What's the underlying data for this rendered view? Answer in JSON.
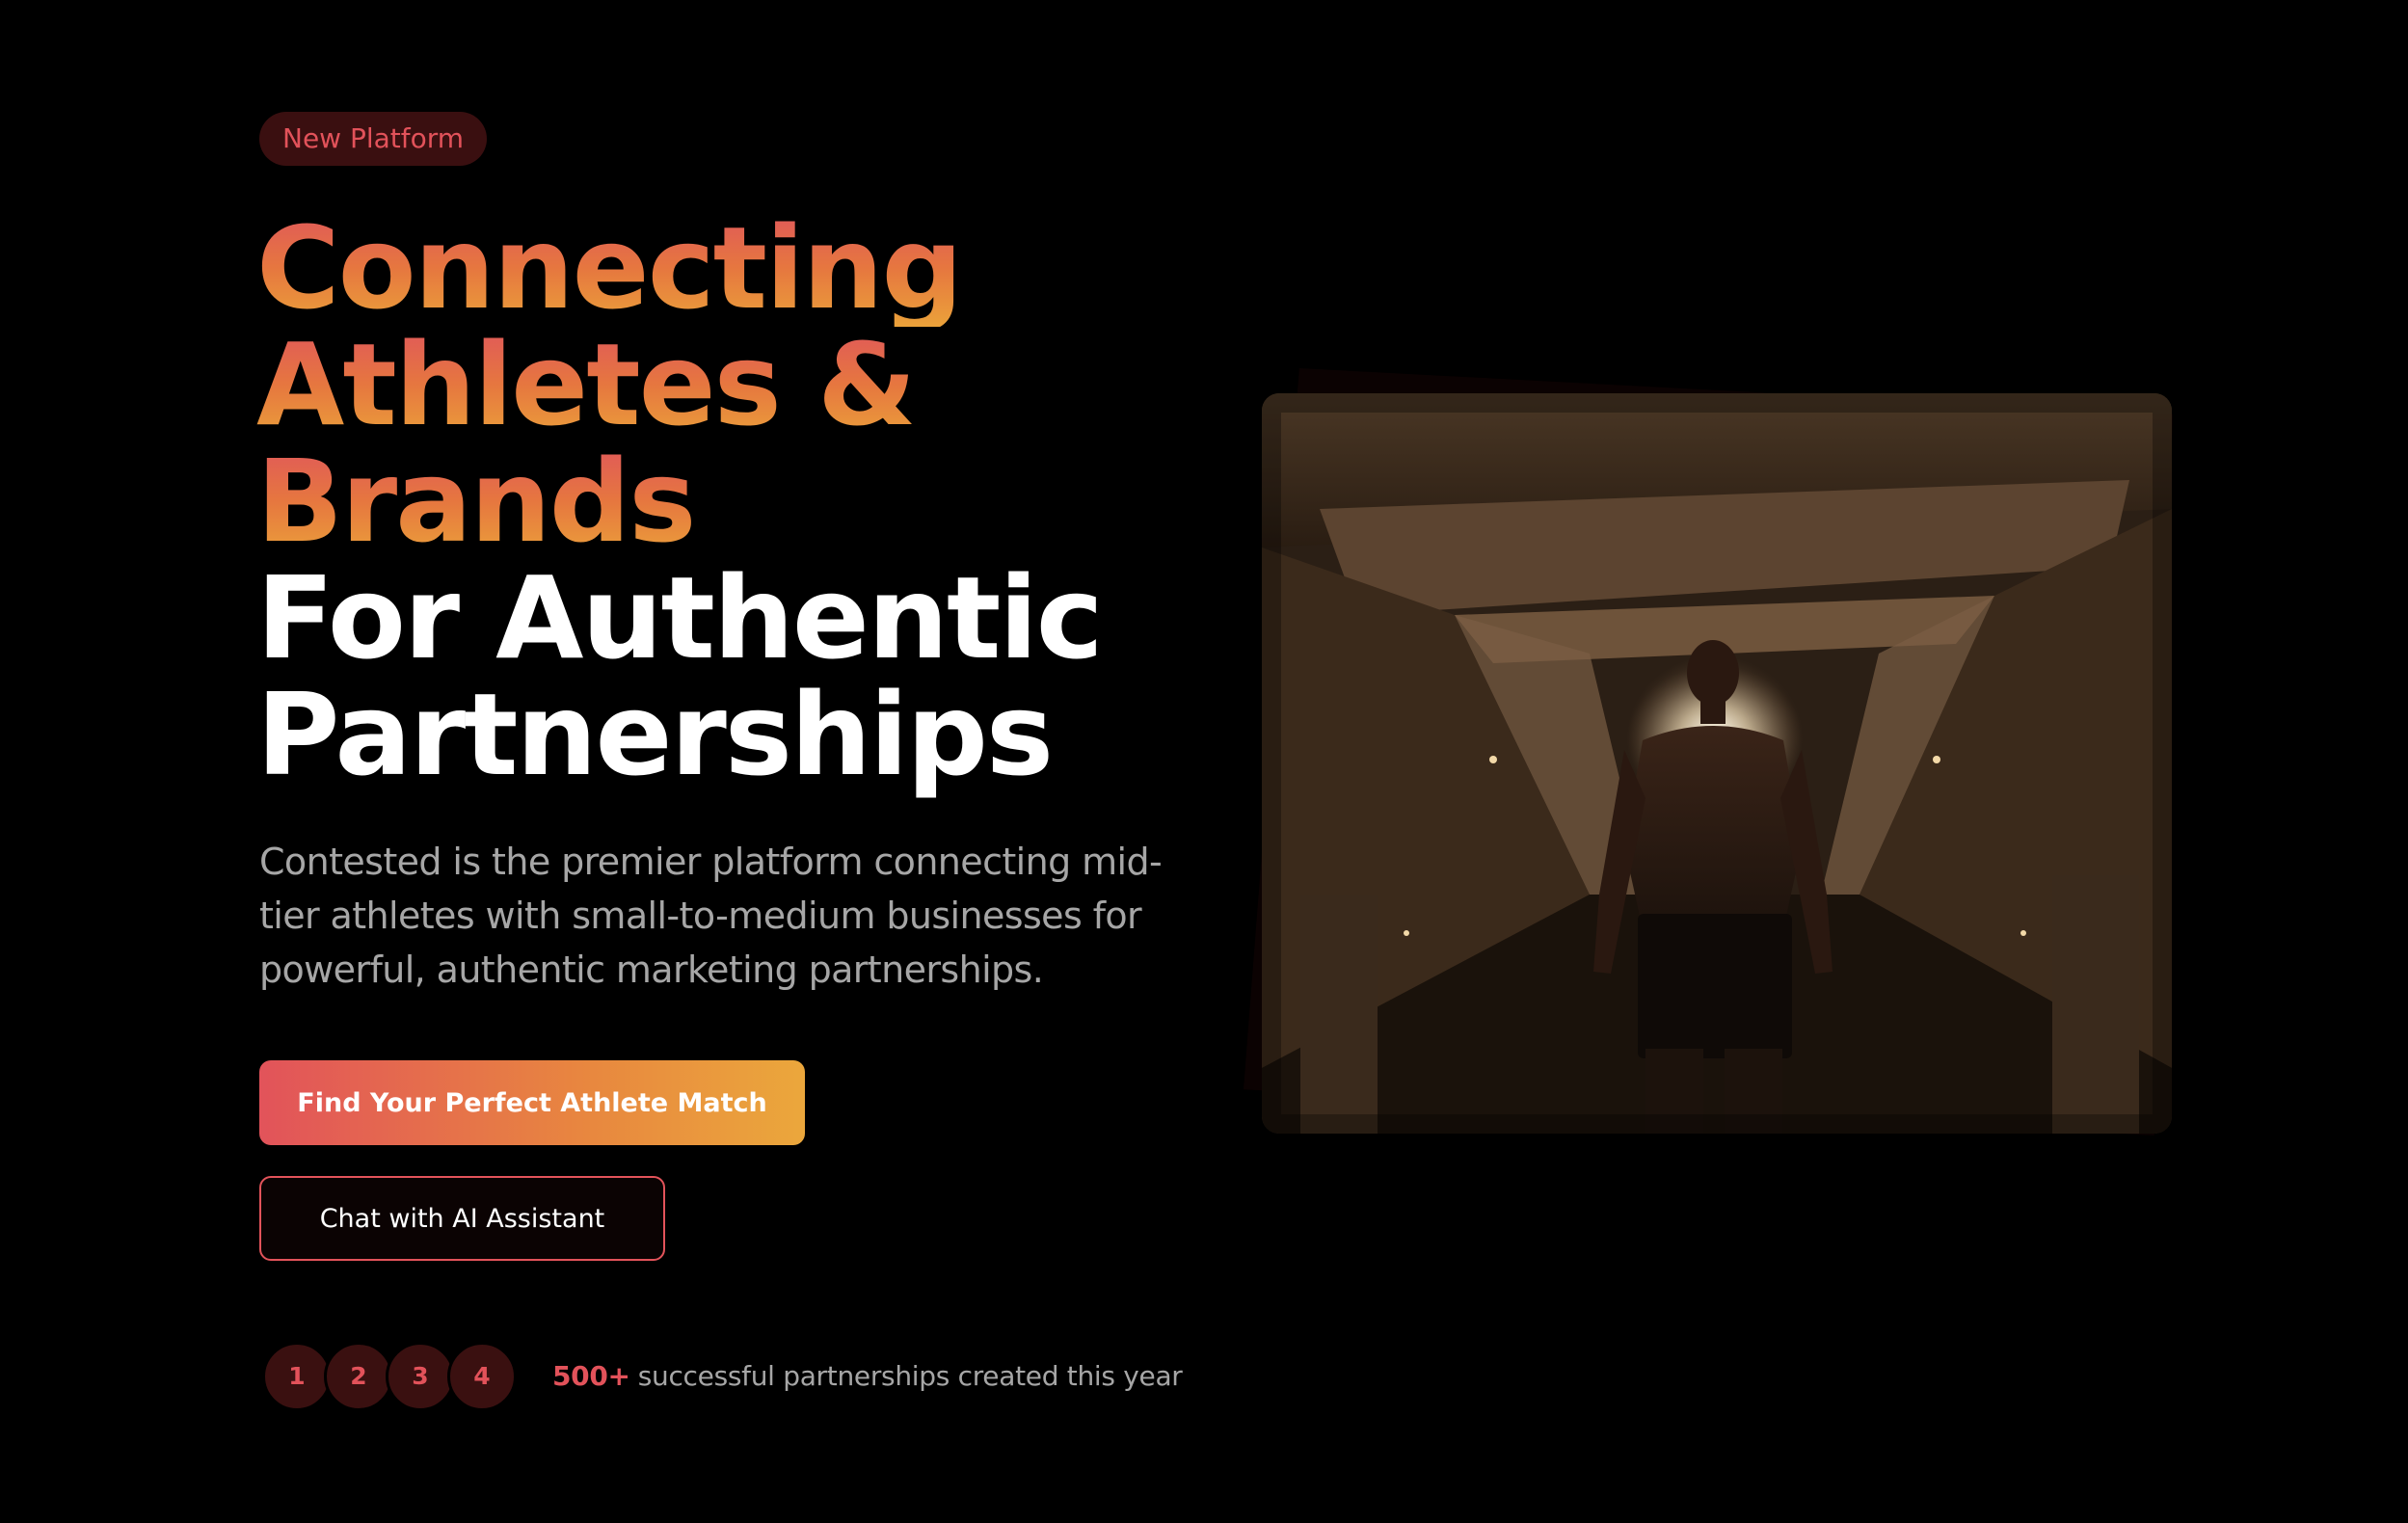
{
  "badge": {
    "label": "New Platform"
  },
  "hero": {
    "headline_gradient_lines": [
      "Connecting",
      "Athletes &",
      "Brands"
    ],
    "headline_white_lines": [
      "For Authentic",
      "Partnerships"
    ],
    "description": "Contested is the premier platform connecting mid-tier athletes with small-to-medium businesses for powerful, authentic marketing partnerships."
  },
  "buttons": {
    "primary_label": "Find Your Perfect Athlete Match",
    "secondary_label": "Chat with AI Assistant"
  },
  "social_proof": {
    "avatars": [
      "1",
      "2",
      "3",
      "4"
    ],
    "count": "500+",
    "text": "successful partnerships created this year"
  },
  "colors": {
    "background": "#000000",
    "accent_red": "#e2525a",
    "accent_orange": "#eba73c",
    "muted_text": "#a6a6a6"
  }
}
